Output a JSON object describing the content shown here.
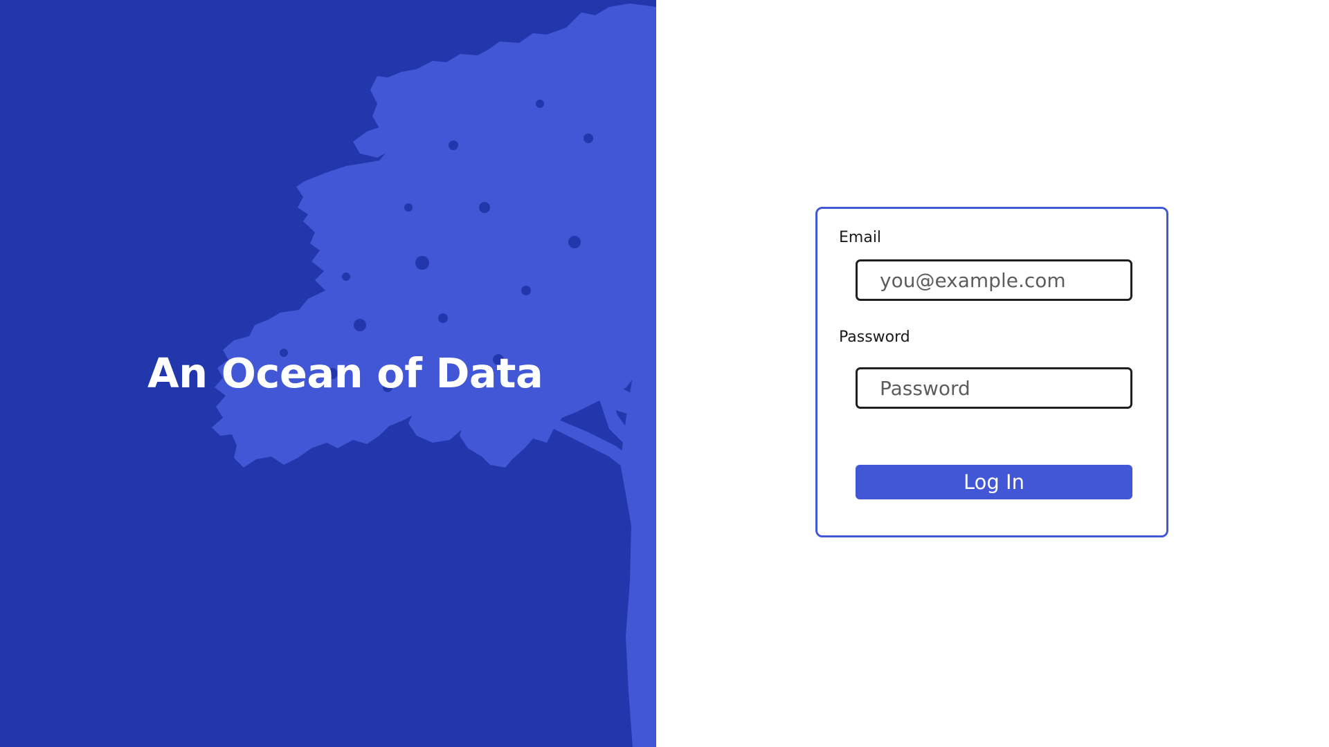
{
  "hero": {
    "title": "An Ocean of Data",
    "background_color": "#2237ac",
    "illustration": "tree-silhouette",
    "illustration_color": "#4257d6"
  },
  "login_form": {
    "email": {
      "label": "Email",
      "placeholder": "you@example.com",
      "value": ""
    },
    "password": {
      "label": "Password",
      "placeholder": "Password",
      "value": ""
    },
    "submit_label": "Log In",
    "accent_color": "#4257d6"
  }
}
